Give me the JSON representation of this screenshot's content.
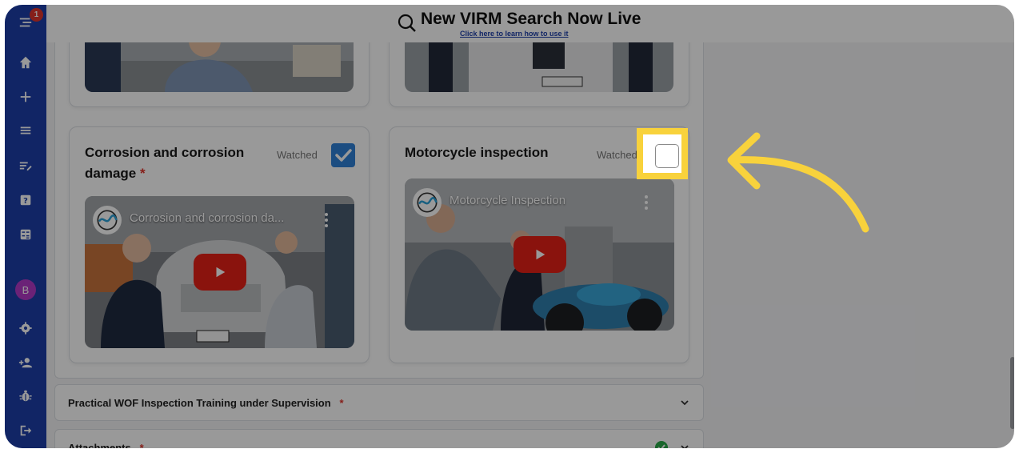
{
  "banner": {
    "title": "New VIRM Search Now Live",
    "link": "Click here to learn how to use it"
  },
  "sidebar": {
    "badge_count": "1",
    "avatar_letter": "B",
    "icons": [
      "menu-icon",
      "home-icon",
      "plus-icon",
      "list-icon",
      "edit-list-icon",
      "help-icon",
      "calculator-icon",
      "settings-icon",
      "add-user-icon",
      "bug-icon",
      "logout-icon"
    ]
  },
  "cards": [
    {
      "title": "Corrosion and corrosion damage",
      "required": "*",
      "watched_label": "Watched",
      "watched": true,
      "video_title": "Corrosion and corrosion da..."
    },
    {
      "title": "Motorcycle inspection",
      "watched_label": "Watched",
      "watched": false,
      "video_title": "Motorcycle Inspection"
    }
  ],
  "sections": [
    {
      "label": "Practical WOF Inspection Training under Supervision",
      "required": "*"
    },
    {
      "label": "Attachments",
      "required": "*",
      "complete": true
    }
  ],
  "colors": {
    "sidebar": "#1d3fa8",
    "checkbox_checked": "#2f80d8",
    "highlight": "#f8d23c",
    "play_button": "#e62117",
    "required": "#e0342c",
    "complete": "#2bab4a"
  }
}
